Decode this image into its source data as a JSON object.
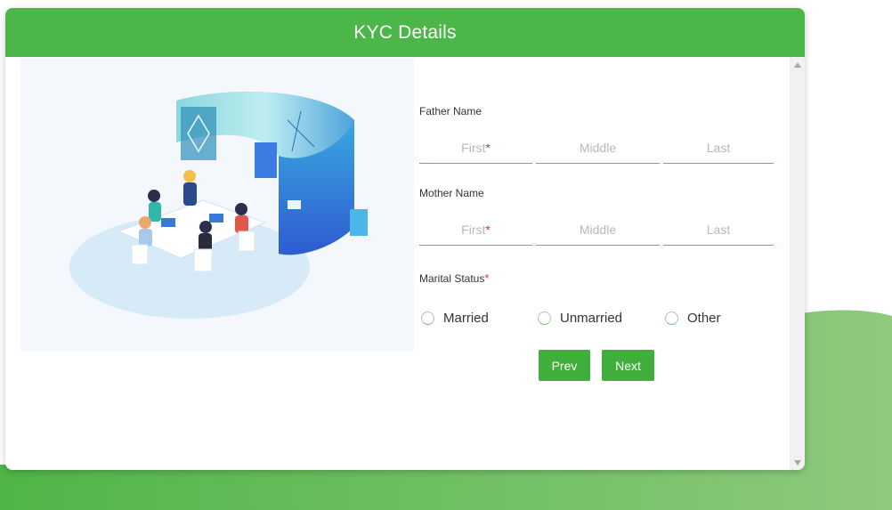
{
  "header": {
    "title": "KYC Details"
  },
  "father": {
    "label": "Father Name",
    "first_placeholder": "First",
    "first_required": "*",
    "middle_placeholder": "Middle",
    "last_placeholder": "Last"
  },
  "mother": {
    "label": "Mother Name",
    "first_placeholder": "First",
    "first_required": "*",
    "middle_placeholder": "Middle",
    "last_placeholder": "Last"
  },
  "marital": {
    "label": "Marital Status",
    "required": "*",
    "options": [
      "Married",
      "Unmarried",
      "Other"
    ]
  },
  "buttons": {
    "prev": "Prev",
    "next": "Next"
  },
  "colors": {
    "header": "#4db648",
    "button": "#3fae3b",
    "underline": "#5cbf55",
    "required": "#e5322d",
    "background_wave": "#58b74f"
  },
  "icons": {
    "scroll_up": "triangle-up",
    "scroll_down": "triangle-down"
  }
}
